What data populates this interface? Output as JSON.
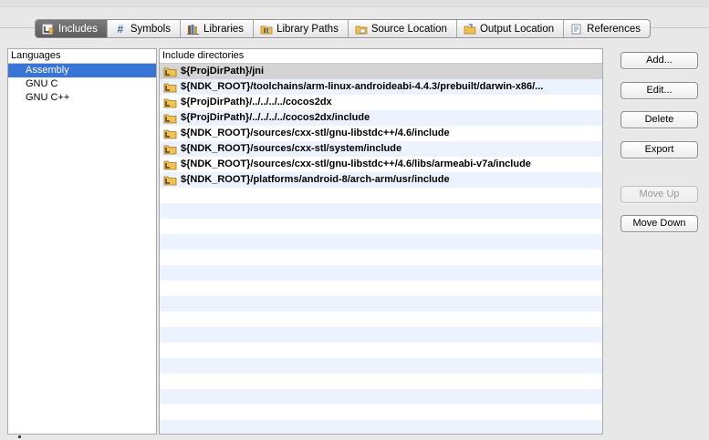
{
  "tabs": [
    {
      "label": "Includes",
      "icon": "includes-icon",
      "active": true
    },
    {
      "label": "Symbols",
      "icon": "hash-icon"
    },
    {
      "label": "Libraries",
      "icon": "libraries-icon"
    },
    {
      "label": "Library Paths",
      "icon": "library-paths-icon"
    },
    {
      "label": "Source Location",
      "icon": "source-folder-icon"
    },
    {
      "label": "Output Location",
      "icon": "output-folder-icon"
    },
    {
      "label": "References",
      "icon": "references-icon"
    }
  ],
  "languages": {
    "header": "Languages",
    "items": [
      "Assembly",
      "GNU C",
      "GNU C++"
    ],
    "selected": "Assembly"
  },
  "include_dirs": {
    "header": "Include directories",
    "items": [
      "${ProjDirPath}/jni",
      "${NDK_ROOT}/toolchains/arm-linux-androideabi-4.4.3/prebuilt/darwin-x86/...",
      "${ProjDirPath}/../../../../cocos2dx",
      "${ProjDirPath}/../../../../cocos2dx/include",
      "${NDK_ROOT}/sources/cxx-stl/gnu-libstdc++/4.6/include",
      "${NDK_ROOT}/sources/cxx-stl/system/include",
      "${NDK_ROOT}/sources/cxx-stl/gnu-libstdc++/4.6/libs/armeabi-v7a/include",
      "${NDK_ROOT}/platforms/android-8/arch-arm/usr/include"
    ]
  },
  "buttons": {
    "add": "Add...",
    "edit": "Edit...",
    "delete": "Delete",
    "export": "Export",
    "move_up": "Move Up",
    "move_down": "Move Down"
  },
  "colors": {
    "selection": "#3875d7",
    "row_stripe": "#edf3fe",
    "selected_row": "#d4d4d4"
  }
}
